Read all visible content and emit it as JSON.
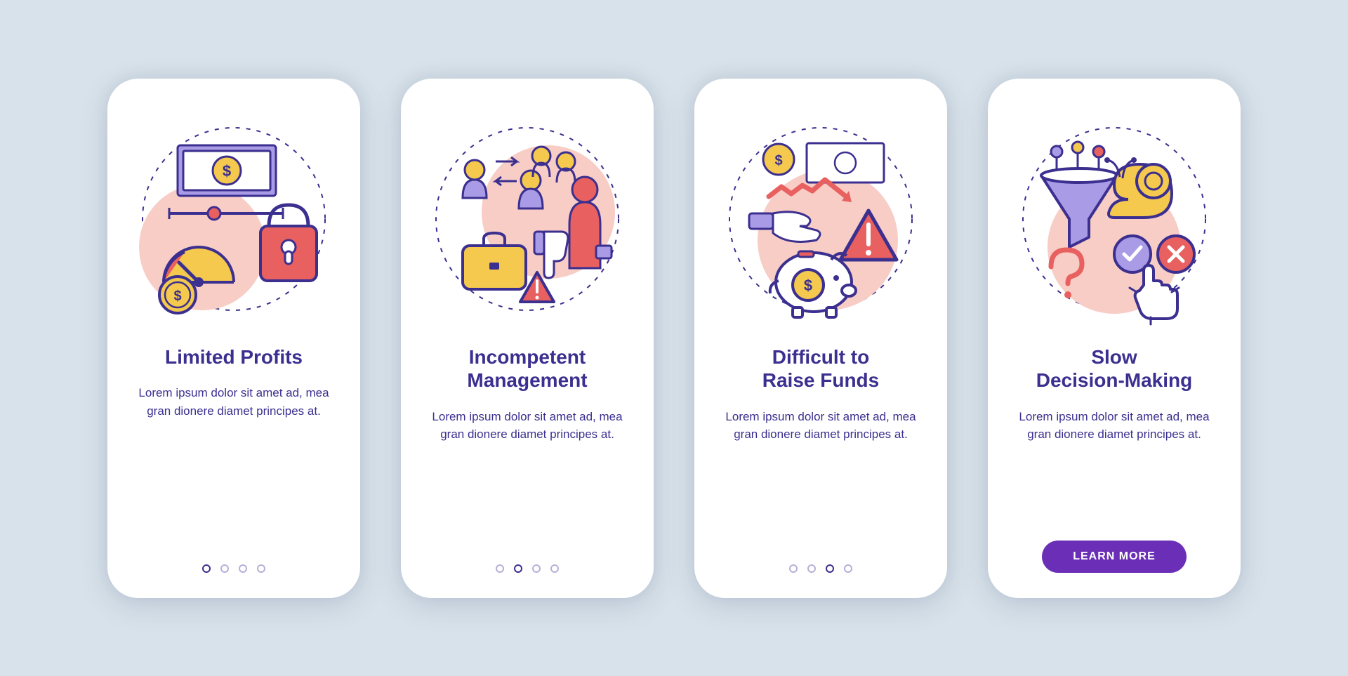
{
  "common": {
    "desc": "Lorem ipsum dolor sit amet ad, mea gran dionere diamet principes at.",
    "cta_label": "LEARN MORE"
  },
  "colors": {
    "purple": "#3b2f8f",
    "lilac": "#a99be6",
    "red": "#e8605f",
    "yellow": "#f4c94e",
    "white": "#ffffff",
    "peach": "#f7cdc6"
  },
  "screens": [
    {
      "id": "limited-profits",
      "title": "Limited Profits",
      "icon": "profits-lock-gauge-icon",
      "active_dot": 0,
      "has_cta": false
    },
    {
      "id": "incompetent-management",
      "title": "Incompetent\nManagement",
      "icon": "management-people-briefcase-icon",
      "active_dot": 1,
      "has_cta": false
    },
    {
      "id": "difficult-raise-funds",
      "title": "Difficult to\nRaise Funds",
      "icon": "funds-piggybank-warning-icon",
      "active_dot": 2,
      "has_cta": false
    },
    {
      "id": "slow-decision-making",
      "title": "Slow\nDecision-Making",
      "icon": "snail-funnel-choice-icon",
      "active_dot": 3,
      "has_cta": true
    }
  ]
}
